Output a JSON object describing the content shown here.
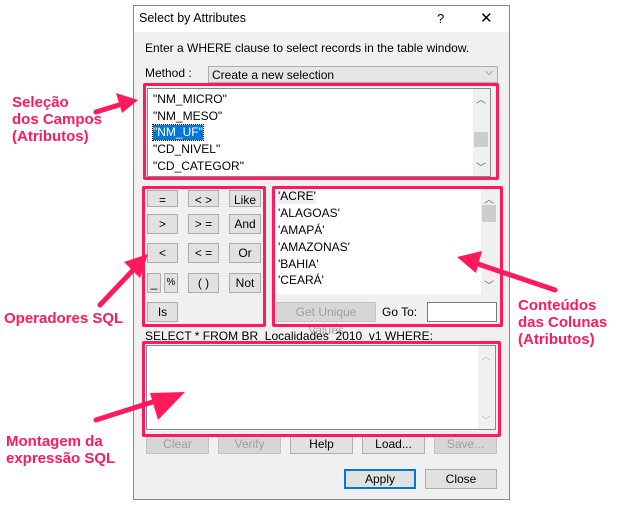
{
  "dialog": {
    "title": "Select by Attributes",
    "help": "?",
    "close": "✕",
    "instruction": "Enter a WHERE clause to select records in the table window.",
    "method_label": "Method :",
    "method_value": "Create a new selection",
    "fields": [
      "\"NM_MICRO\"",
      "\"NM_MESO\"",
      "\"NM_UF\"",
      "\"CD_NIVEL\"",
      "\"CD_CATEGOR\""
    ],
    "selected_field": "\"NM_UF\"",
    "operators": {
      "eq": "=",
      "ne": "< >",
      "like": "Like",
      "gt": ">",
      "ge": "> =",
      "and": "And",
      "lt": "<",
      "le": "< =",
      "or": "Or",
      "underscore": "_",
      "percent": "%",
      "parens": "( )",
      "not": "Not",
      "is": "Is"
    },
    "values": [
      "'ACRE'",
      "'ALAGOAS'",
      "'AMAPÁ'",
      "'AMAZONAS'",
      "'BAHIA'",
      "'CEARÁ'"
    ],
    "get_unique": "Get Unique Values",
    "goto_label": "Go To:",
    "goto_value": "",
    "select_text": "SELECT * FROM BR_Localidades_2010_v1 WHERE:",
    "expression": "",
    "buttons": {
      "clear": "Clear",
      "verify": "Verify",
      "help": "Help",
      "load": "Load...",
      "save": "Save...",
      "apply": "Apply",
      "close": "Close"
    }
  },
  "annotations": {
    "fields": [
      "Seleção",
      "dos Campos",
      "(Atributos)"
    ],
    "operators": "Operadores SQL",
    "values": [
      "Conteúdos",
      "das Colunas",
      "(Atributos)"
    ],
    "expression": [
      "Montagem da",
      "expressão SQL"
    ]
  },
  "colors": {
    "annotation": "#ff1a5e",
    "selection": "#0078d7"
  }
}
